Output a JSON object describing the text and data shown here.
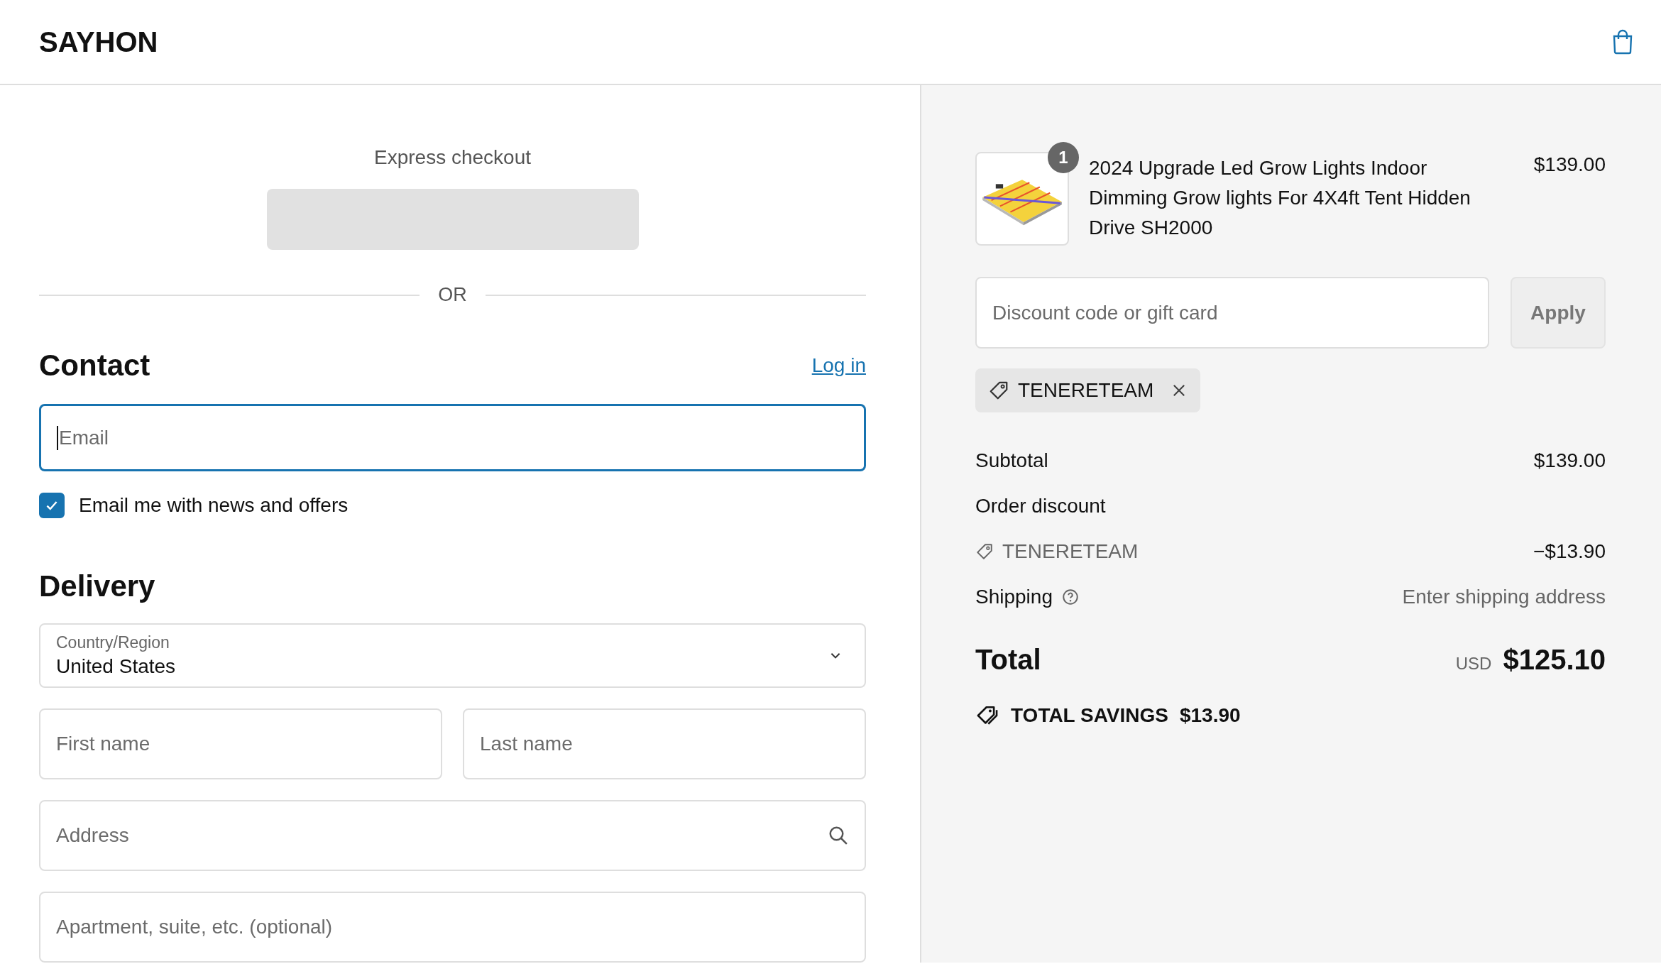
{
  "header": {
    "logo": "SAYHON"
  },
  "express_checkout": {
    "label": "Express checkout",
    "divider": "OR"
  },
  "contact": {
    "heading": "Contact",
    "login_link": "Log in",
    "email": {
      "placeholder": "Email",
      "focused": true
    },
    "newsletter": {
      "label": "Email me with news and offers",
      "checked": true
    }
  },
  "delivery": {
    "heading": "Delivery",
    "country": {
      "label": "Country/Region",
      "value": "United States"
    },
    "fields": [
      {
        "placeholder": "First name",
        "kind": "half"
      },
      {
        "placeholder": "Last name",
        "kind": "half"
      },
      {
        "placeholder": "Address",
        "kind": "search"
      },
      {
        "placeholder": "Apartment, suite, etc. (optional)",
        "kind": "full"
      }
    ]
  },
  "summary": {
    "product": {
      "quantity": "1",
      "name": "2024 Upgrade Led Grow Lights Indoor Dimming Grow lights For 4X4ft Tent Hidden Drive SH2000",
      "price": "$139.00"
    },
    "discount": {
      "placeholder": "Discount code or gift card",
      "button": "Apply"
    },
    "applied_codes": [
      {
        "code": "TENERETEAM"
      }
    ],
    "lines": [
      {
        "kind": "plain",
        "label": "Subtotal",
        "value": "$139.00"
      },
      {
        "kind": "heading",
        "label": "Order discount"
      },
      {
        "kind": "code",
        "label": "TENERETEAM",
        "value": "−$13.90"
      },
      {
        "kind": "help",
        "label": "Shipping",
        "value": "Enter shipping address"
      }
    ],
    "total": {
      "label": "Total",
      "currency": "USD",
      "amount": "$125.10"
    },
    "savings": {
      "label": "TOTAL SAVINGS",
      "amount": "$13.90"
    }
  }
}
